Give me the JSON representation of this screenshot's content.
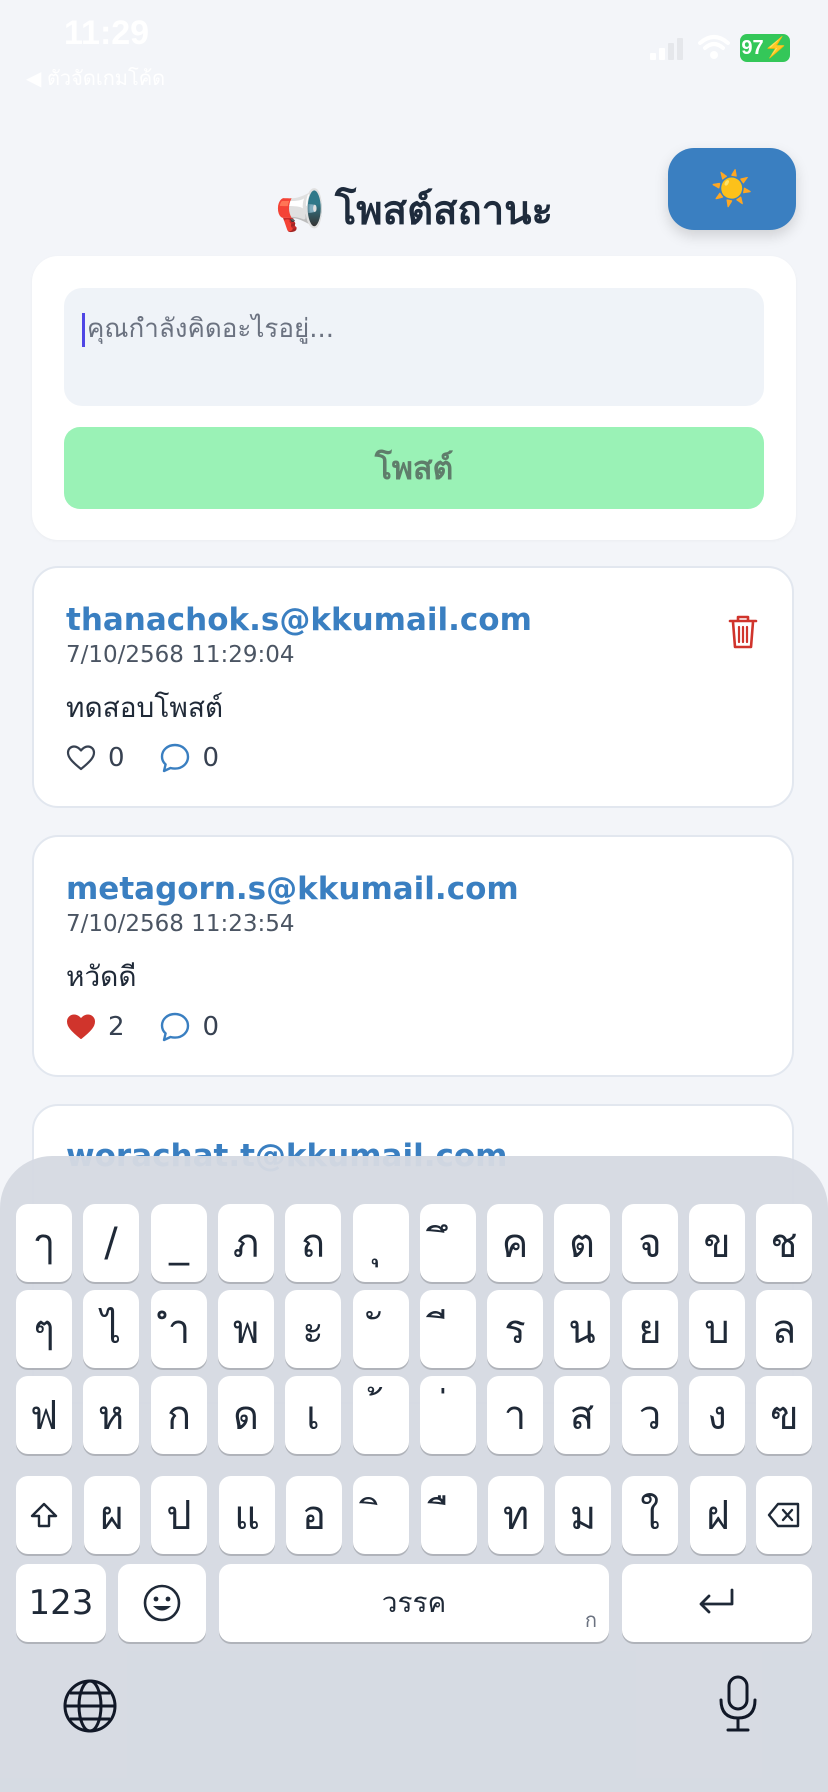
{
  "status_bar": {
    "time": "11:29",
    "back_label": "◀ ตัวจัดเกมโค้ด",
    "battery": "97"
  },
  "header": {
    "title": "โพสต์สถานะ",
    "megaphone": "📢",
    "theme_button_icon": "☀️"
  },
  "compose": {
    "placeholder": "คุณกำลังคิดอะไรอยู่...",
    "post_label": "โพสต์"
  },
  "posts": [
    {
      "email": "thanachok.s@kkumail.com",
      "timestamp": "7/10/2568 11:29:04",
      "content": "ทดสอบโพสต์",
      "likes": "0",
      "comments": "0",
      "liked": false,
      "can_delete": true
    },
    {
      "email": "metagorn.s@kkumail.com",
      "timestamp": "7/10/2568 11:23:54",
      "content": "หวัดดี",
      "likes": "2",
      "comments": "0",
      "liked": true,
      "can_delete": false
    },
    {
      "email": "worachat.t@kkumail.com",
      "timestamp": "",
      "content": "",
      "likes": "",
      "comments": "",
      "liked": false,
      "can_delete": false
    }
  ],
  "keyboard": {
    "row1": [
      "ๅ",
      "/",
      "_",
      "ภ",
      "ถ",
      "ุ",
      "ึ",
      "ค",
      "ต",
      "จ",
      "ข",
      "ช"
    ],
    "row2": [
      "ๆ",
      "ไ",
      "ำ",
      "พ",
      "ะ",
      "ั",
      "ี",
      "ร",
      "น",
      "ย",
      "บ",
      "ล"
    ],
    "row3": [
      "ฟ",
      "ห",
      "ก",
      "ด",
      "เ",
      "้",
      "่",
      "า",
      "ส",
      "ว",
      "ง",
      "ฃ"
    ],
    "row4": [
      "ผ",
      "ป",
      "แ",
      "อ",
      "ิ",
      "ื",
      "ท",
      "ม",
      "ใ",
      "ฝ"
    ],
    "numbers_label": "123",
    "space_label": "วรรค",
    "space_sub": "ก"
  },
  "colors": {
    "accent": "#3a7fc1",
    "post_button": "#9af2b6",
    "like_active": "#d0342c",
    "delete": "#d0342c"
  }
}
